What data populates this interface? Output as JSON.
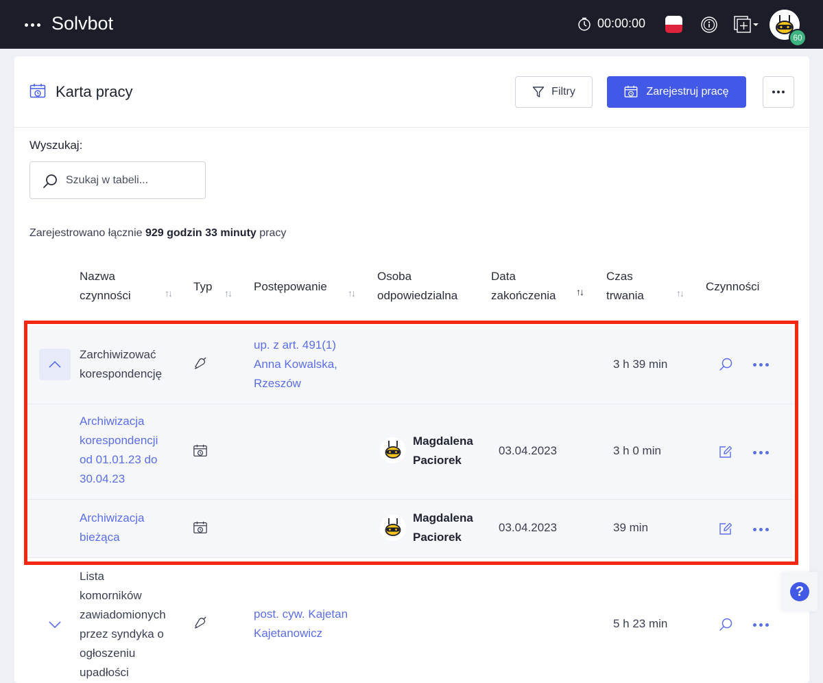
{
  "topbar": {
    "app_title": "Solvbot",
    "timer": "00:00:00",
    "avatar_badge": "60",
    "icons": [
      "menu-dots-icon",
      "timer-icon",
      "flag-pl-icon",
      "info-icon",
      "add-window-icon",
      "avatar"
    ]
  },
  "header": {
    "title": "Karta pracy",
    "filters_label": "Filtry",
    "register_label": "Zarejestruj pracę"
  },
  "search": {
    "label": "Wyszukaj:",
    "placeholder": "Szukaj w tabeli..."
  },
  "summary": {
    "prefix": "Zarejestrowano łącznie",
    "total": "929 godzin 33 minuty",
    "suffix": "pracy"
  },
  "columns": {
    "name_l1": "Nazwa",
    "name_l2": "czynności",
    "type": "Typ",
    "case": "Postępowanie",
    "person_l1": "Osoba",
    "person_l2": "odpowiedzialna",
    "date_l1": "Data",
    "date_l2": "zakończenia",
    "duration_l1": "Czas",
    "duration_l2": "trwania",
    "actions": "Czynności"
  },
  "rows": [
    {
      "name": [
        "Zarchiwizować",
        "korespondencję"
      ],
      "type_icon": "task-bell-icon",
      "case": [
        "up. z art. 491(1)",
        "Anna Kowalska,",
        "Rzeszów"
      ],
      "person": "",
      "date": "",
      "duration": "3 h 39 min",
      "expanded": true
    },
    {
      "name": [
        "Archiwizacja",
        "korespondencji",
        "od 01.01.23 do",
        "30.04.23"
      ],
      "type_icon": "calendar-clock-icon",
      "case": [],
      "person": [
        "Magdalena",
        "Paciorek"
      ],
      "date": "03.04.2023",
      "duration": "3 h 0 min"
    },
    {
      "name": [
        "Archiwizacja",
        "bieżąca"
      ],
      "type_icon": "calendar-clock-icon",
      "case": [],
      "person": [
        "Magdalena",
        "Paciorek"
      ],
      "date": "03.04.2023",
      "duration": "39 min"
    },
    {
      "name": [
        "Lista",
        "komorników",
        "zawiadomionych",
        "przez syndyka o",
        "ogłoszeniu",
        "upadłości"
      ],
      "type_icon": "task-bell-icon",
      "case": [
        "post. cyw. Kajetan",
        "Kajetanowicz"
      ],
      "person": "",
      "date": "",
      "duration": "5 h 23 min",
      "expanded": false
    }
  ],
  "help": {
    "label": "?"
  },
  "colors": {
    "topbar_bg": "#1b1d29",
    "primary": "#4159e6",
    "link": "#5b6ee8",
    "highlight": "#f32712",
    "badge": "#3fb37f"
  }
}
